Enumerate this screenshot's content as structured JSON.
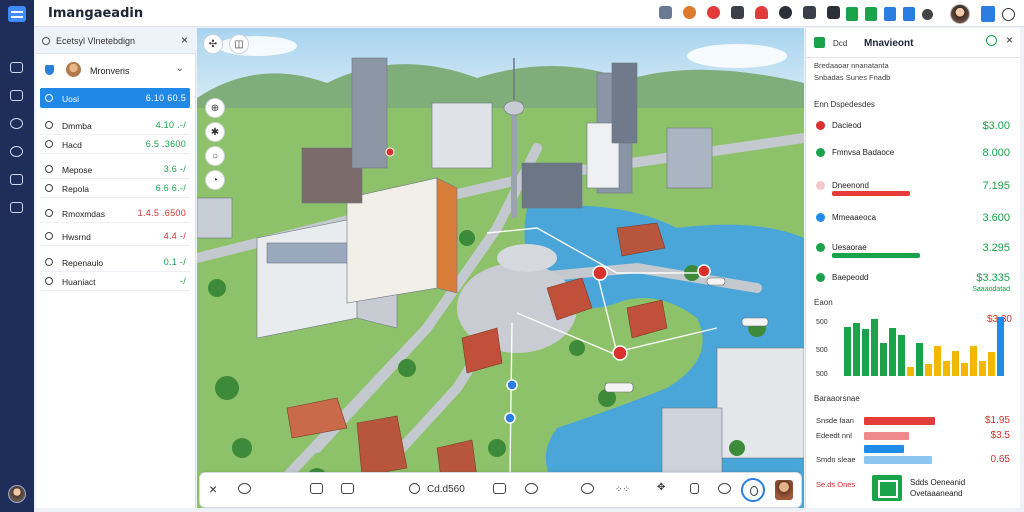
{
  "app": {
    "title": "Imangaeadin"
  },
  "topbar": {
    "icons": [
      "tool-icon",
      "palette-icon",
      "sync-icon",
      "pencil-icon",
      "bell-icon",
      "shield-icon",
      "folder-icon",
      "bookmark-icon"
    ],
    "right_icons": [
      "doc-icon",
      "chart-icon",
      "box-icon",
      "doc-blue-icon",
      "gear-icon"
    ],
    "accent": "#2a7de1"
  },
  "left_panel": {
    "header": "Ecetsyl Vlnetebdign",
    "user": "Mronveris",
    "rows": [
      {
        "label": "Uosi",
        "value": "6.10 60.5",
        "color": "#ffffff",
        "selected": true
      },
      {
        "label": "Dmmba",
        "value": "4.10 .‑/",
        "color": "#1aa34a"
      },
      {
        "label": "Hacd",
        "value": "6.5 .3600",
        "color": "#1aa34a"
      },
      {
        "label": "Mepose",
        "value": "3.6 ‑/",
        "color": "#1aa34a"
      },
      {
        "label": "Repola",
        "value": "6.6 6.‑/",
        "color": "#1aa34a"
      },
      {
        "label": "Rmoxmdas",
        "value": "1.4.5 .6500",
        "color": "#d9312b"
      },
      {
        "label": "Hwsrnd",
        "value": "4.4 ‑/",
        "color": "#d9312b"
      },
      {
        "label": "Repenaulo",
        "value": "0.1 ‑/",
        "color": "#1aa34a"
      },
      {
        "label": "Huaniact",
        "value": "‑/",
        "color": "#1aa34a"
      }
    ]
  },
  "map": {
    "tools": [
      "tool-cross",
      "tool-layers"
    ],
    "side_tools": [
      "pin-tool",
      "compass-tool",
      "circle-tool",
      "history-tool"
    ]
  },
  "bottom_bar": {
    "close": "×",
    "zoom_label": "Cd.d560",
    "tools": [
      "route-icon",
      "image-icon",
      "photo-icon",
      "clock-icon",
      "doc-icon",
      "refresh-icon",
      "spinner-icon",
      "sparkle-icon",
      "grid-icon",
      "lock-icon",
      "marker-icon"
    ]
  },
  "right_panel": {
    "tag": "Dcd",
    "title": "Mnavieont",
    "subtitles": [
      "Bredaaoar nnanatanta",
      "Snbadas  Sunes  Fnadb"
    ],
    "section1": "Enn  Dspedesdes",
    "metrics": [
      {
        "label": "Dacieod",
        "value": "$3.00",
        "color": "#d9312b",
        "value_color": "#1aa34a",
        "bar": 0,
        "bar_color": ""
      },
      {
        "label": "Fmnvsa Badaoce",
        "value": "8.000",
        "color": "#1aa34a",
        "value_color": "#1aa34a",
        "bar": 0,
        "bar_color": ""
      },
      {
        "label": "Dneenond",
        "value": "7.195",
        "color": "#f4c9c9",
        "value_color": "#1aa34a",
        "bar": 0.78,
        "bar_color": "#e53b3b"
      },
      {
        "label": "Mmeaaeoca",
        "value": "3.600",
        "color": "#1e8ce8",
        "value_color": "#1aa34a",
        "bar": 0,
        "bar_color": ""
      },
      {
        "label": "Uesaorae",
        "value": "3.295",
        "color": "#1aa34a",
        "value_color": "#1aa34a",
        "bar": 0.88,
        "bar_color": "#1aa34a"
      },
      {
        "label": "Baepeodd",
        "value": "$3.335",
        "color": "#1aa34a",
        "value_color": "#1aa34a",
        "bar": 0,
        "bar_color": "",
        "sub": "Saaaodatad"
      }
    ],
    "chart_section": "Eaon",
    "chart_data": {
      "type": "bar",
      "ytick_labels": [
        "500",
        "500",
        "500"
      ],
      "values": [
        0.82,
        0.88,
        0.78,
        0.95,
        0.55,
        0.8,
        0.68,
        0.15,
        0.55,
        0.2,
        0.5,
        0.25,
        0.42,
        0.22,
        0.5,
        0.25,
        0.4,
        0.98
      ],
      "colors": [
        "#1aa34a",
        "#1aa34a",
        "#1aa34a",
        "#1aa34a",
        "#1aa34a",
        "#1aa34a",
        "#1aa34a",
        "#f2b800",
        "#1aa34a",
        "#f2b800",
        "#f2b800",
        "#f2b800",
        "#f2b800",
        "#f2b800",
        "#f2b800",
        "#f2b800",
        "#f2b800",
        "#1e8ce8"
      ],
      "value_label": "$3.30"
    },
    "section2": "Baraaorsnae",
    "hbars": [
      {
        "label": "Snsde faan",
        "value": "$1.95",
        "fill": 0.98,
        "color": "#e53b3b"
      },
      {
        "label": "Edeedt nnl",
        "value": "$3.5",
        "fill": 0.62,
        "color": "#f08a8a"
      },
      {
        "label": "",
        "value": "",
        "fill": 0.55,
        "color": "#1e8ce8"
      },
      {
        "label": "Smdn sleae",
        "value": "0.65",
        "fill": 0.95,
        "color": "#8cc6f0"
      }
    ],
    "footer": {
      "label": "Se.ds Ones",
      "line1": "Sdds Oeneanid",
      "line2": "Ovetaaaneand"
    }
  }
}
